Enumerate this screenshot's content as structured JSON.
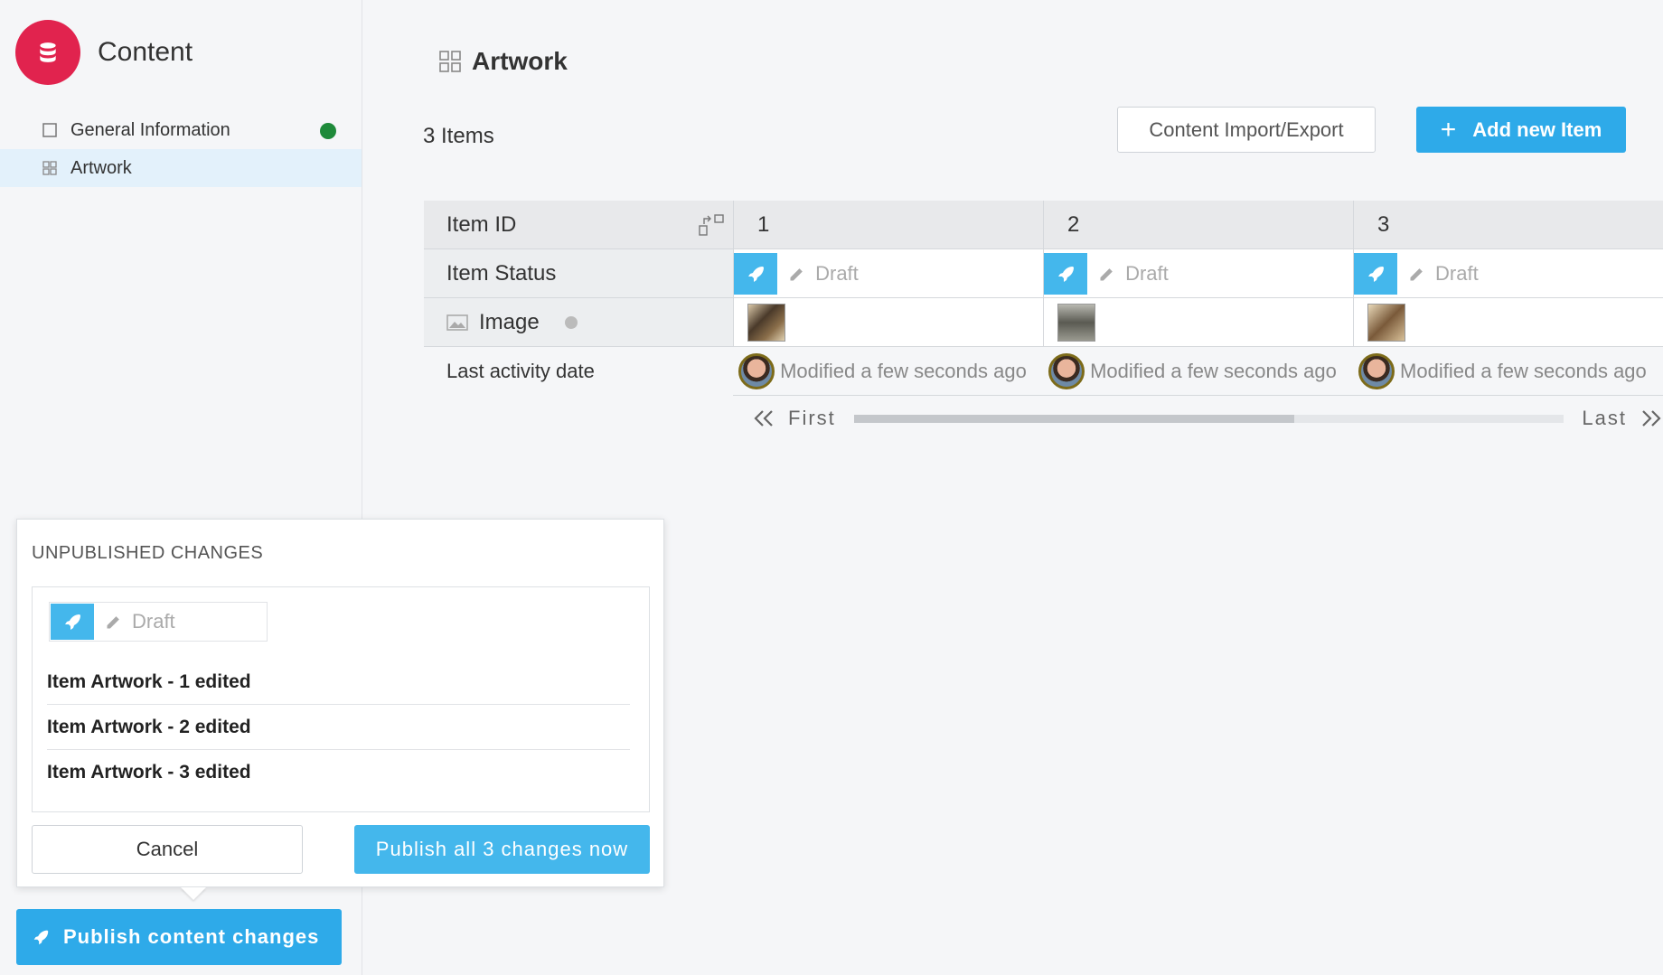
{
  "app": {
    "title": "Content",
    "brand_icon": "database-icon",
    "brand_color": "#e1234e"
  },
  "sidebar": {
    "items": [
      {
        "label": "General Information",
        "icon": "square-icon",
        "status": "green-dot"
      },
      {
        "label": "Artwork",
        "icon": "grid-icon",
        "active": true
      }
    ],
    "publish_button_label": "Publish content changes"
  },
  "main": {
    "title": "Artwork",
    "items_count": "3 Items",
    "import_export_label": "Content Import/Export",
    "add_item_label": "Add new Item"
  },
  "table": {
    "row_headers": {
      "id": "Item ID",
      "status": "Item Status",
      "image": "Image",
      "last_activity": "Last activity date"
    },
    "columns": [
      {
        "id": "1",
        "status": "Draft",
        "modified": "Modified a few seconds ago"
      },
      {
        "id": "2",
        "status": "Draft",
        "modified": "Modified a few seconds ago"
      },
      {
        "id": "3",
        "status": "Draft",
        "modified": "Modified a few seconds ago"
      }
    ]
  },
  "pager": {
    "first": "First",
    "last": "Last",
    "scroll_fraction": 0.62
  },
  "popup": {
    "title": "UNPUBLISHED CHANGES",
    "status": "Draft",
    "changes": [
      "Item Artwork - 1  edited",
      "Item Artwork - 2  edited",
      "Item Artwork - 3  edited"
    ],
    "cancel_label": "Cancel",
    "publish_all_label": "Publish all 3 changes now"
  },
  "colors": {
    "accent": "#2eaae9",
    "draft_icon_bg": "#44b7ec",
    "active_row": "#e3f1fb"
  }
}
